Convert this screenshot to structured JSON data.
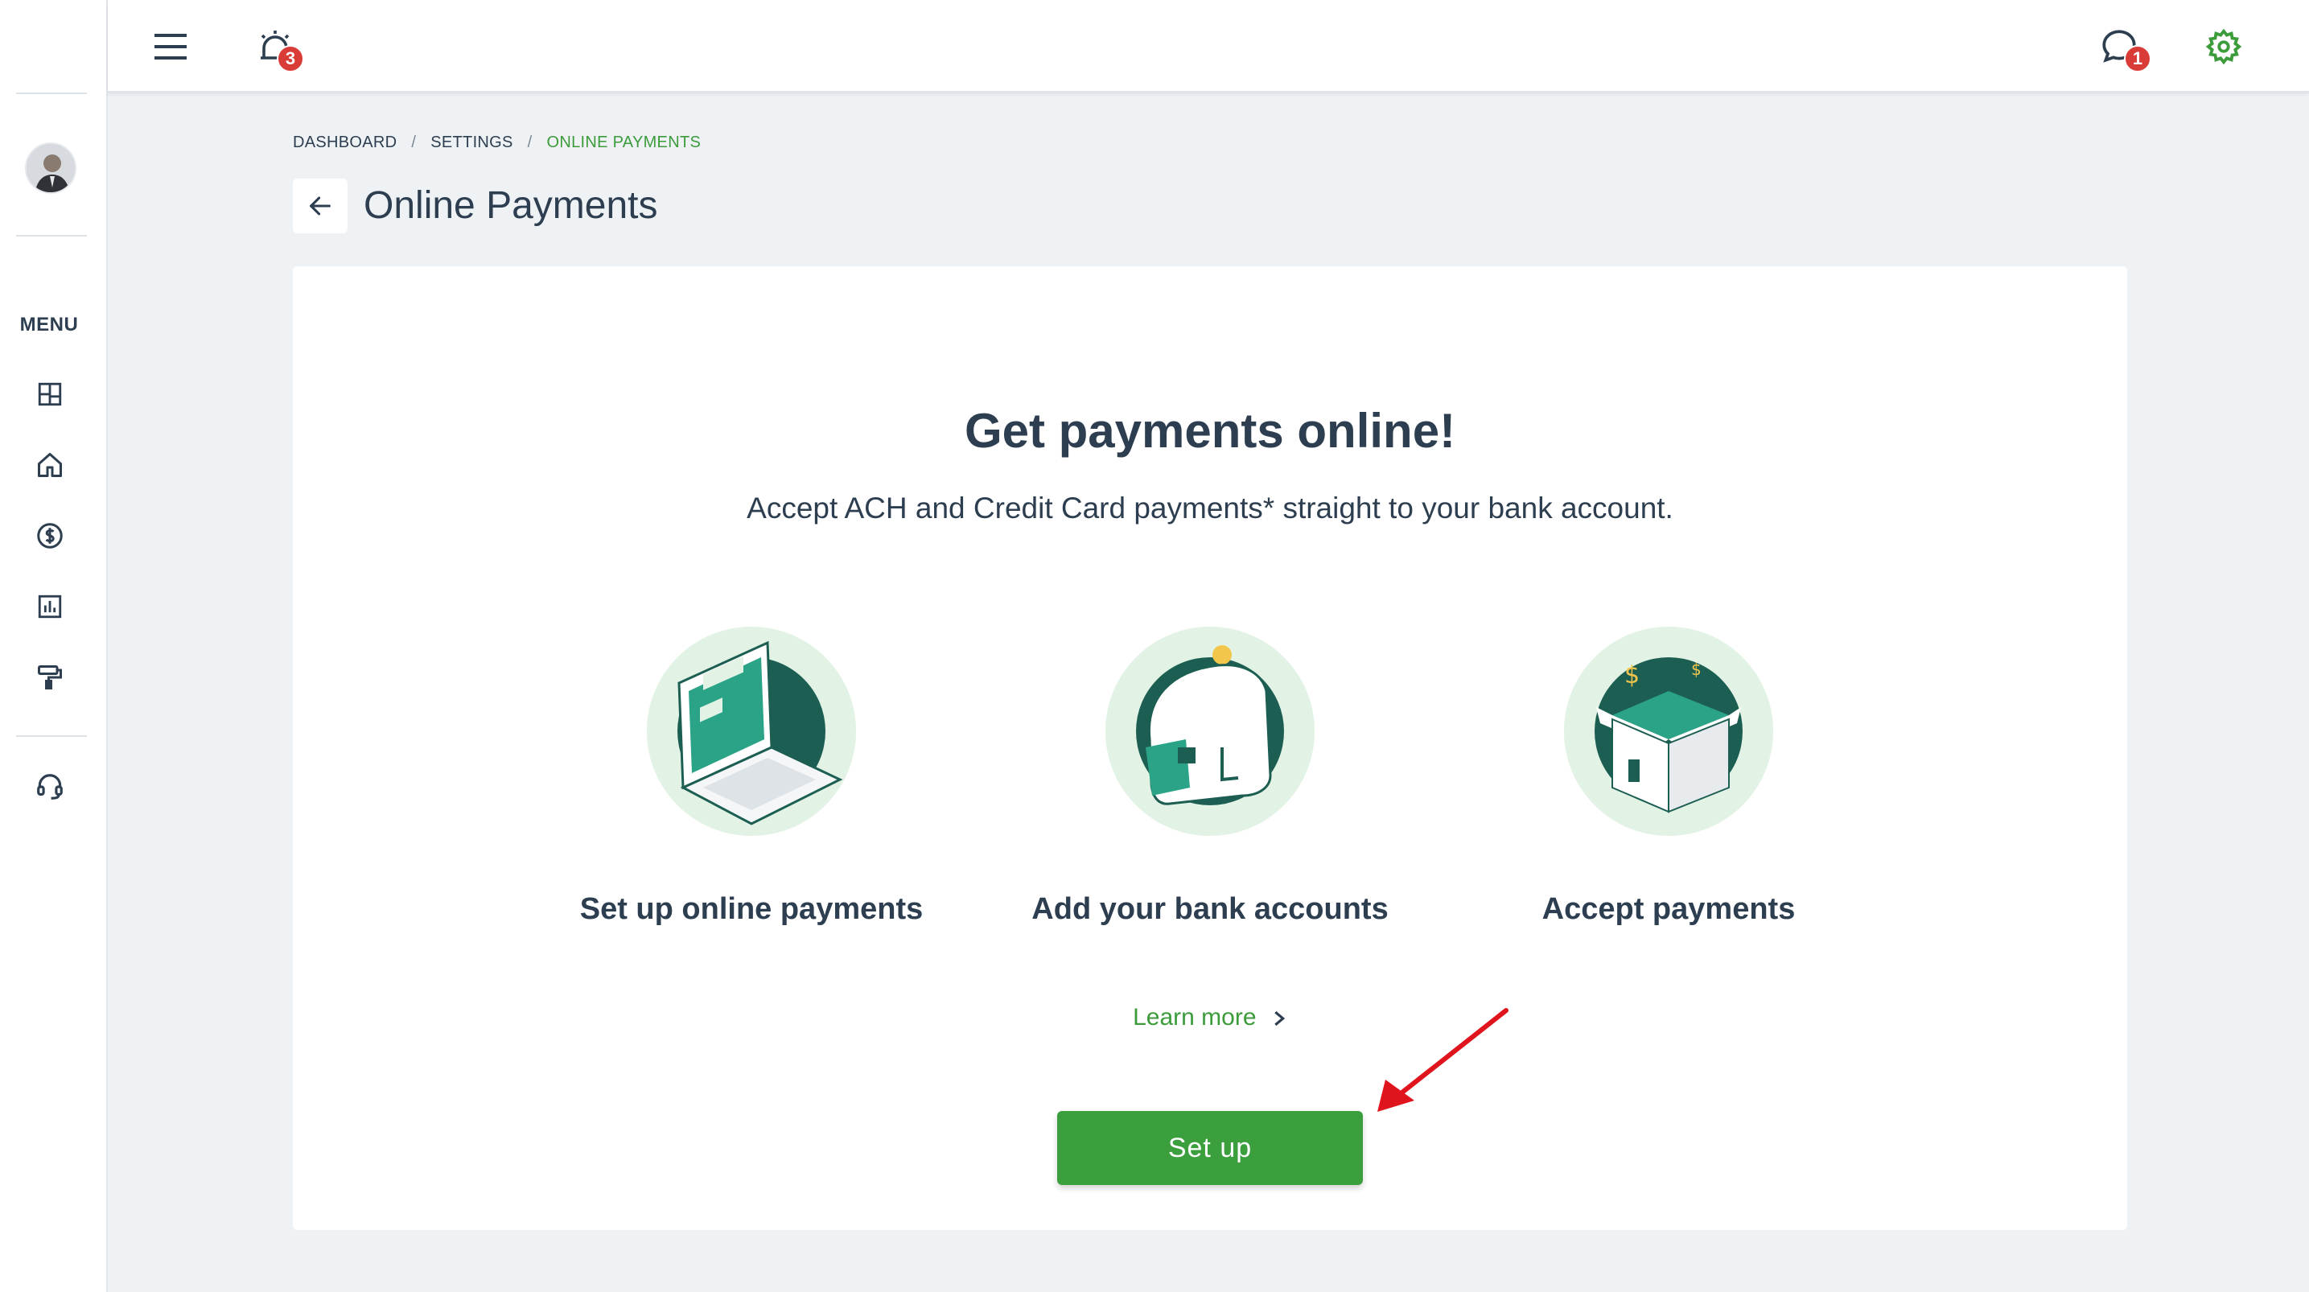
{
  "topbar": {
    "alerts_badge": "3",
    "messages_badge": "1"
  },
  "sidebar": {
    "menu_label": "MENU",
    "items": [
      {
        "icon": "dashboard-icon"
      },
      {
        "icon": "home-icon"
      },
      {
        "icon": "dollar-icon"
      },
      {
        "icon": "reports-icon"
      },
      {
        "icon": "paint-roller-icon"
      },
      {
        "icon": "support-headset-icon"
      }
    ]
  },
  "breadcrumb": {
    "items": [
      "DASHBOARD",
      "SETTINGS",
      "ONLINE PAYMENTS"
    ],
    "separator": "/"
  },
  "page": {
    "title": "Online Payments"
  },
  "card": {
    "headline": "Get payments online!",
    "subline": "Accept ACH and Credit Card payments* straight to your bank account.",
    "features": [
      {
        "label": "Set up online payments",
        "icon": "laptop-illustration"
      },
      {
        "label": "Add your bank accounts",
        "icon": "wallet-illustration"
      },
      {
        "label": "Accept payments",
        "icon": "open-box-illustration"
      }
    ],
    "learn_more": "Learn more",
    "setup_button": "Set up"
  },
  "colors": {
    "brand_green": "#3c9f3e",
    "text_dark": "#2d3e50",
    "badge_red": "#d93b37",
    "annotation_arrow": "#e0141c"
  }
}
